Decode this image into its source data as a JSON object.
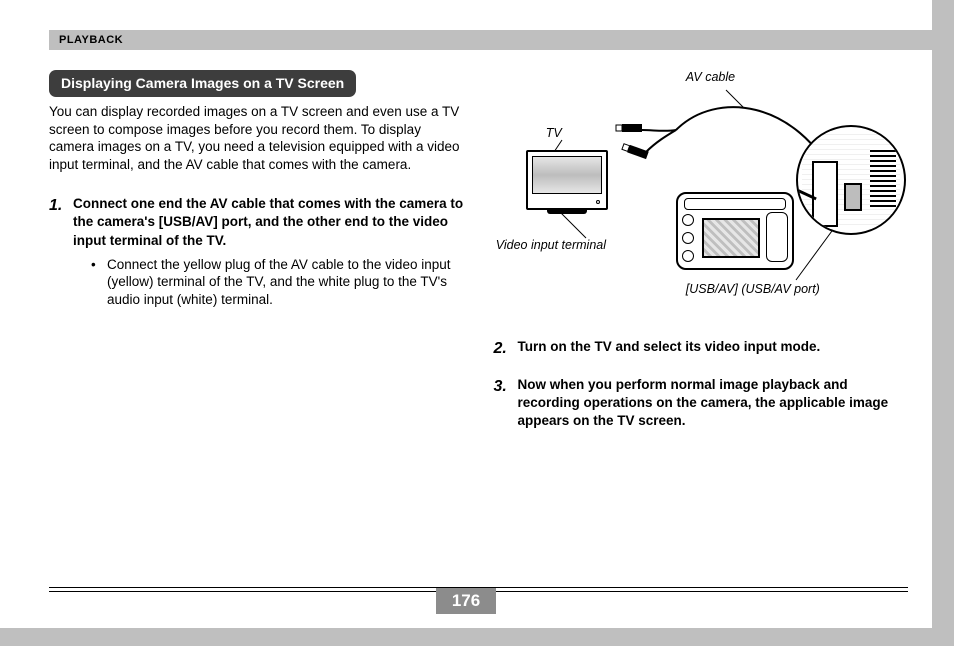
{
  "header": {
    "section": "PLAYBACK"
  },
  "heading": "Displaying Camera Images on a TV Screen",
  "intro": "You can display recorded images on a TV screen and even use a TV screen to compose images before you record them. To display camera images on a TV, you need a television equipped with a video input terminal, and the AV cable that comes with the camera.",
  "steps": [
    {
      "num": "1.",
      "title": "Connect one end the AV cable that comes with the camera to the camera's [USB/AV] port, and the other end to the video input terminal of the TV.",
      "bullets": [
        "Connect the yellow plug of the AV cable to the video input (yellow) terminal of the TV, and the white plug to the TV's audio input (white) terminal."
      ]
    },
    {
      "num": "2.",
      "title": "Turn on the TV and select its video input mode.",
      "bullets": []
    },
    {
      "num": "3.",
      "title": "Now when you perform normal image playback and recording operations on the camera, the applicable image appears on the TV screen.",
      "bullets": []
    }
  ],
  "diagram": {
    "labels": {
      "av_cable": "AV cable",
      "tv": "TV",
      "video_input": "Video input terminal",
      "usb_av_port": "[USB/AV] (USB/AV port)"
    }
  },
  "page_number": "176"
}
